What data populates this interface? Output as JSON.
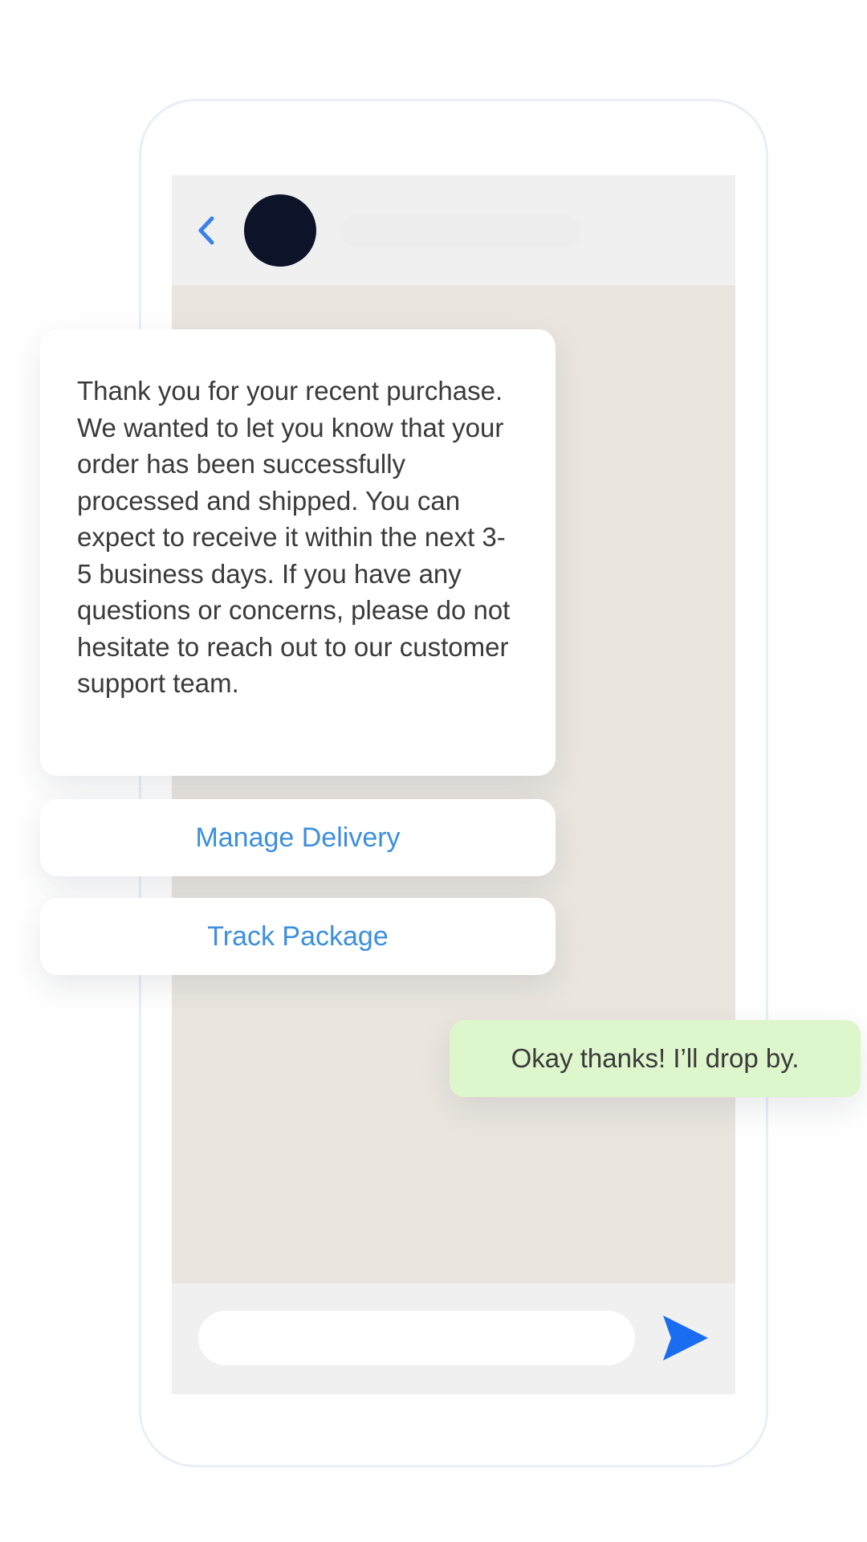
{
  "chat": {
    "header": {
      "back_icon": "chevron-left-icon",
      "avatar_color": "#0d1429"
    },
    "messages": {
      "incoming": {
        "text": "Thank you for your recent purchase. We wanted to let you know that your order has been successfully processed and shipped. You can expect to receive it within the next 3-5 business days. If you have any questions or concerns, please do not hesitate to reach out to our customer support team."
      },
      "actions": [
        {
          "label": "Manage Delivery"
        },
        {
          "label": "Track Package"
        }
      ],
      "outgoing": {
        "text": "Okay thanks! I’ll drop by."
      }
    },
    "composer": {
      "placeholder": "",
      "send_icon": "send-icon"
    }
  },
  "colors": {
    "accent": "#3b8fdc",
    "send": "#1a6cf0",
    "chat_background": "#eae5df",
    "outgoing_bubble": "#def6cc"
  }
}
